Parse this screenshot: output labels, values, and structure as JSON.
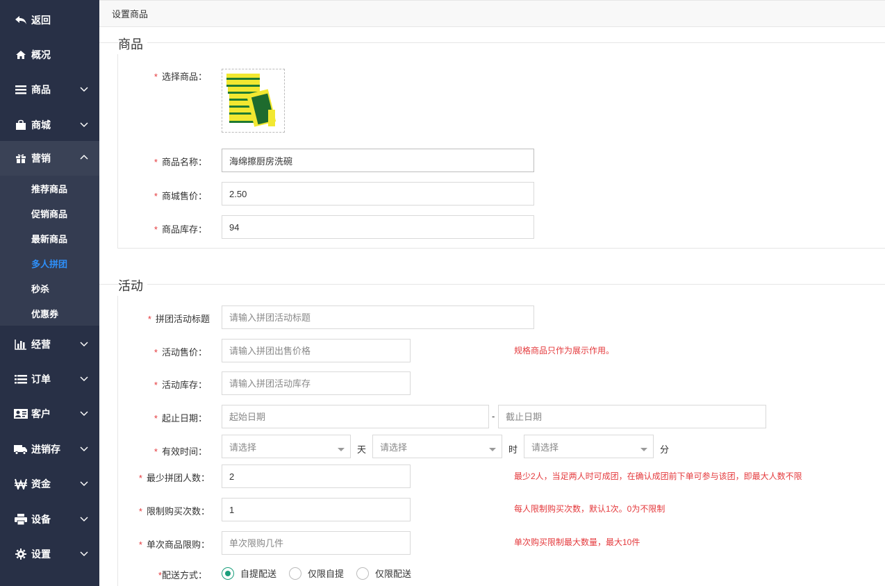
{
  "sidebar": {
    "items": [
      {
        "label": "返回",
        "icon": "back-arrow-icon"
      },
      {
        "label": "概况",
        "icon": "home-icon"
      },
      {
        "label": "商品",
        "icon": "list-icon"
      },
      {
        "label": "商城",
        "icon": "shopping-bag-icon"
      },
      {
        "label": "营销",
        "icon": "gift-icon"
      },
      {
        "label": "经营",
        "icon": "bar-chart-icon"
      },
      {
        "label": "订单",
        "icon": "order-list-icon"
      },
      {
        "label": "客户",
        "icon": "id-card-icon"
      },
      {
        "label": "进销存",
        "icon": "truck-icon"
      },
      {
        "label": "资金",
        "icon": "currency-icon"
      },
      {
        "label": "设备",
        "icon": "printer-icon"
      },
      {
        "label": "设置",
        "icon": "gear-icon"
      }
    ],
    "submenu": [
      {
        "label": "推荐商品"
      },
      {
        "label": "促销商品"
      },
      {
        "label": "最新商品"
      },
      {
        "label": "多人拼团"
      },
      {
        "label": "秒杀"
      },
      {
        "label": "优惠券"
      }
    ],
    "active_color": "#2e90fa"
  },
  "header": {
    "title": "设置商品"
  },
  "product_section": {
    "title": "商品",
    "select_label": "选择商品：",
    "name_label": "商品名称：",
    "name_value": "海绵擦厨房洗碗",
    "price_label": "商城售价：",
    "price_value": "2.50",
    "stock_label": "商品库存：",
    "stock_value": "94"
  },
  "activity_section": {
    "title": "活动",
    "title_label": "拼团活动标题",
    "title_placeholder": "请输入拼团活动标题",
    "price_label": "活动售价：",
    "price_placeholder": "请输入拼团出售价格",
    "price_hint": "规格商品只作为展示作用。",
    "stock_label": "活动库存：",
    "stock_placeholder": "请输入拼团活动库存",
    "date_label": "起止日期：",
    "start_placeholder": "起始日期",
    "date_separator": "-",
    "end_placeholder": "截止日期",
    "valid_label": "有效时间：",
    "select_placeholder": "请选择",
    "unit_day": "天",
    "unit_hour": "时",
    "unit_minute": "分",
    "min_people_label": "最少拼团人数：",
    "min_people_value": "2",
    "min_people_hint": "最少2人，当足两人时可成团，在确认成团前下单可参与该团，即最大人数不限",
    "limit_times_label": "限制购买次数：",
    "limit_times_value": "1",
    "limit_times_hint": "每人限制购买次数，默认1次。0为不限制",
    "single_limit_label": "单次商品限购：",
    "single_limit_placeholder": "单次限购几件",
    "single_limit_hint": "单次购买限制最大数量，最大10件",
    "delivery_label": "配送方式：",
    "delivery_options": [
      {
        "label": "自提配送",
        "checked": true
      },
      {
        "label": "仅限自提",
        "checked": false
      },
      {
        "label": "仅限配送",
        "checked": false
      }
    ]
  },
  "colors": {
    "sidebar_bg": "#283046",
    "required": "#e4393c",
    "radio_checked": "#1a9e7b"
  }
}
